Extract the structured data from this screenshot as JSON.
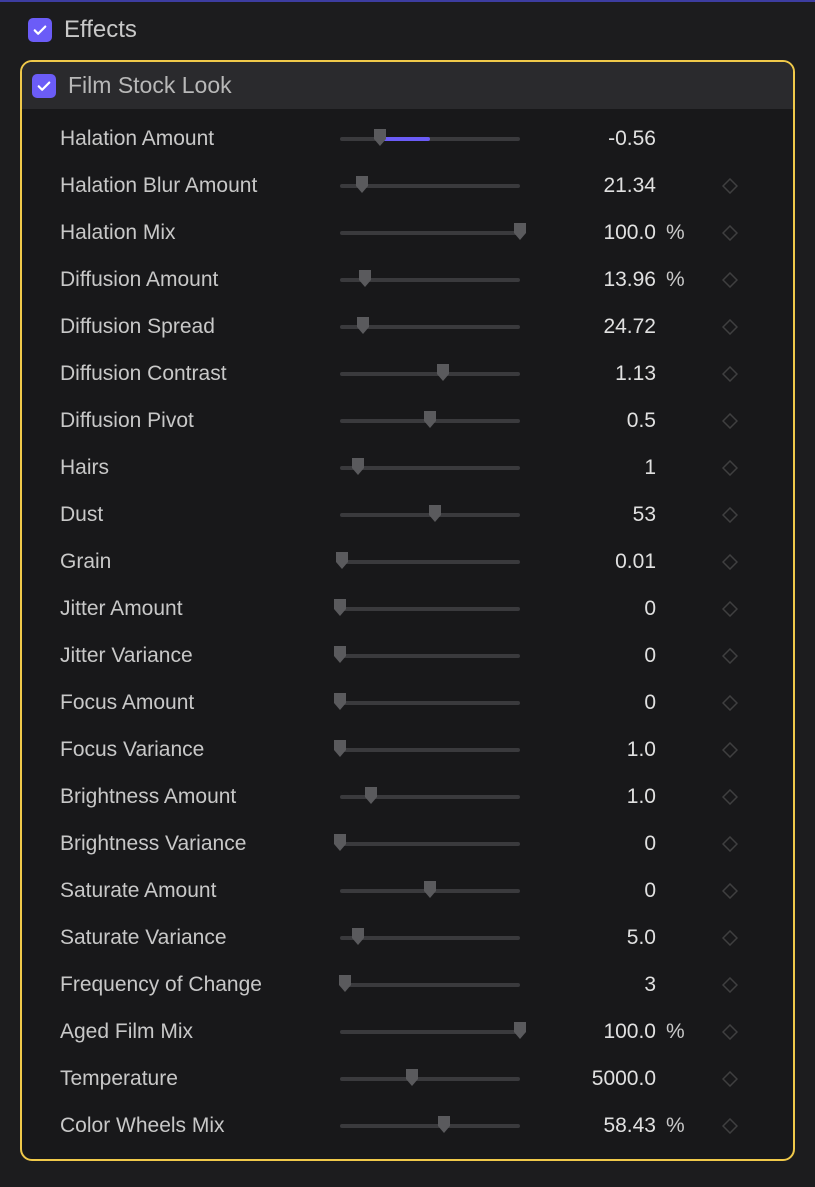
{
  "colors": {
    "accent": "#6b5cf7",
    "highlight": "#f0c94a"
  },
  "header": {
    "effects_label": "Effects"
  },
  "panel": {
    "title": "Film Stock Look"
  },
  "params": [
    {
      "label": "Halation Amount",
      "value": "-0.56",
      "unit": "",
      "pos": 22,
      "fill_from": 22,
      "fill_to": 50,
      "keyframe": false
    },
    {
      "label": "Halation Blur Amount",
      "value": "21.34",
      "unit": "",
      "pos": 12,
      "fill_from": null,
      "fill_to": null,
      "keyframe": true
    },
    {
      "label": "Halation Mix",
      "value": "100.0",
      "unit": "%",
      "pos": 100,
      "fill_from": null,
      "fill_to": null,
      "keyframe": true
    },
    {
      "label": "Diffusion Amount",
      "value": "13.96",
      "unit": "%",
      "pos": 14,
      "fill_from": null,
      "fill_to": null,
      "keyframe": true
    },
    {
      "label": "Diffusion Spread",
      "value": "24.72",
      "unit": "",
      "pos": 13,
      "fill_from": null,
      "fill_to": null,
      "keyframe": true
    },
    {
      "label": "Diffusion Contrast",
      "value": "1.13",
      "unit": "",
      "pos": 57,
      "fill_from": null,
      "fill_to": null,
      "keyframe": true
    },
    {
      "label": "Diffusion Pivot",
      "value": "0.5",
      "unit": "",
      "pos": 50,
      "fill_from": null,
      "fill_to": null,
      "keyframe": true
    },
    {
      "label": "Hairs",
      "value": "1",
      "unit": "",
      "pos": 10,
      "fill_from": null,
      "fill_to": null,
      "keyframe": true
    },
    {
      "label": "Dust",
      "value": "53",
      "unit": "",
      "pos": 53,
      "fill_from": null,
      "fill_to": null,
      "keyframe": true
    },
    {
      "label": "Grain",
      "value": "0.01",
      "unit": "",
      "pos": 1,
      "fill_from": null,
      "fill_to": null,
      "keyframe": true
    },
    {
      "label": "Jitter Amount",
      "value": "0",
      "unit": "",
      "pos": 0,
      "fill_from": null,
      "fill_to": null,
      "keyframe": true
    },
    {
      "label": "Jitter Variance",
      "value": "0",
      "unit": "",
      "pos": 0,
      "fill_from": null,
      "fill_to": null,
      "keyframe": true
    },
    {
      "label": "Focus Amount",
      "value": "0",
      "unit": "",
      "pos": 0,
      "fill_from": null,
      "fill_to": null,
      "keyframe": true
    },
    {
      "label": "Focus Variance",
      "value": "1.0",
      "unit": "",
      "pos": 0,
      "fill_from": null,
      "fill_to": null,
      "keyframe": true
    },
    {
      "label": "Brightness Amount",
      "value": "1.0",
      "unit": "",
      "pos": 17,
      "fill_from": null,
      "fill_to": null,
      "keyframe": true
    },
    {
      "label": "Brightness Variance",
      "value": "0",
      "unit": "",
      "pos": 0,
      "fill_from": null,
      "fill_to": null,
      "keyframe": true
    },
    {
      "label": "Saturate Amount",
      "value": "0",
      "unit": "",
      "pos": 50,
      "fill_from": null,
      "fill_to": null,
      "keyframe": true
    },
    {
      "label": "Saturate Variance",
      "value": "5.0",
      "unit": "",
      "pos": 10,
      "fill_from": null,
      "fill_to": null,
      "keyframe": true
    },
    {
      "label": "Frequency of Change",
      "value": "3",
      "unit": "",
      "pos": 3,
      "fill_from": null,
      "fill_to": null,
      "keyframe": true
    },
    {
      "label": "Aged Film Mix",
      "value": "100.0",
      "unit": "%",
      "pos": 100,
      "fill_from": null,
      "fill_to": null,
      "keyframe": true
    },
    {
      "label": "Temperature",
      "value": "5000.0",
      "unit": "",
      "pos": 40,
      "fill_from": null,
      "fill_to": null,
      "keyframe": true
    },
    {
      "label": "Color Wheels Mix",
      "value": "58.43",
      "unit": "%",
      "pos": 58,
      "fill_from": null,
      "fill_to": null,
      "keyframe": true
    }
  ]
}
